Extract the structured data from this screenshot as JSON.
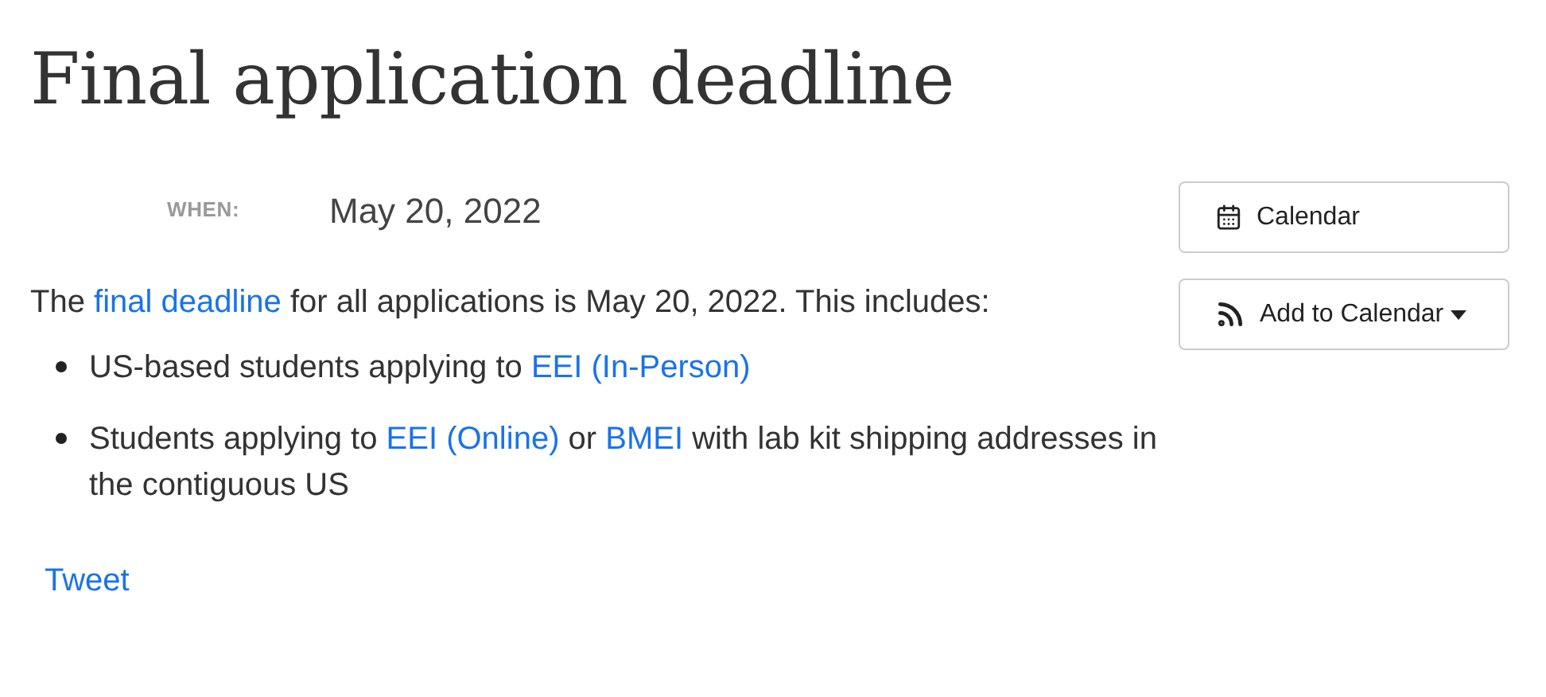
{
  "title": "Final application deadline",
  "when": {
    "label": "WHEN:",
    "value": "May 20, 2022"
  },
  "buttons": [
    {
      "kind": "calendar",
      "label": "Calendar"
    },
    {
      "kind": "feed",
      "label": "Add to Calendar"
    }
  ],
  "intro": [
    {
      "text": "The ",
      "link": false
    },
    {
      "text": "final deadline",
      "link": true
    },
    {
      "text": " for all applications is May 20, 2022. This includes:",
      "link": false
    }
  ],
  "items": [
    [
      {
        "text": "US-based students applying to ",
        "link": false
      },
      {
        "text": "EEI (In-Person)",
        "link": true
      }
    ],
    [
      {
        "text": "Students applying to ",
        "link": false
      },
      {
        "text": "EEI (Online)",
        "link": true
      },
      {
        "text": " or ",
        "link": false
      },
      {
        "text": "BMEI",
        "link": true
      },
      {
        "text": " with lab kit shipping addresses in the contiguous US",
        "link": false
      }
    ]
  ],
  "tweet": "Tweet"
}
